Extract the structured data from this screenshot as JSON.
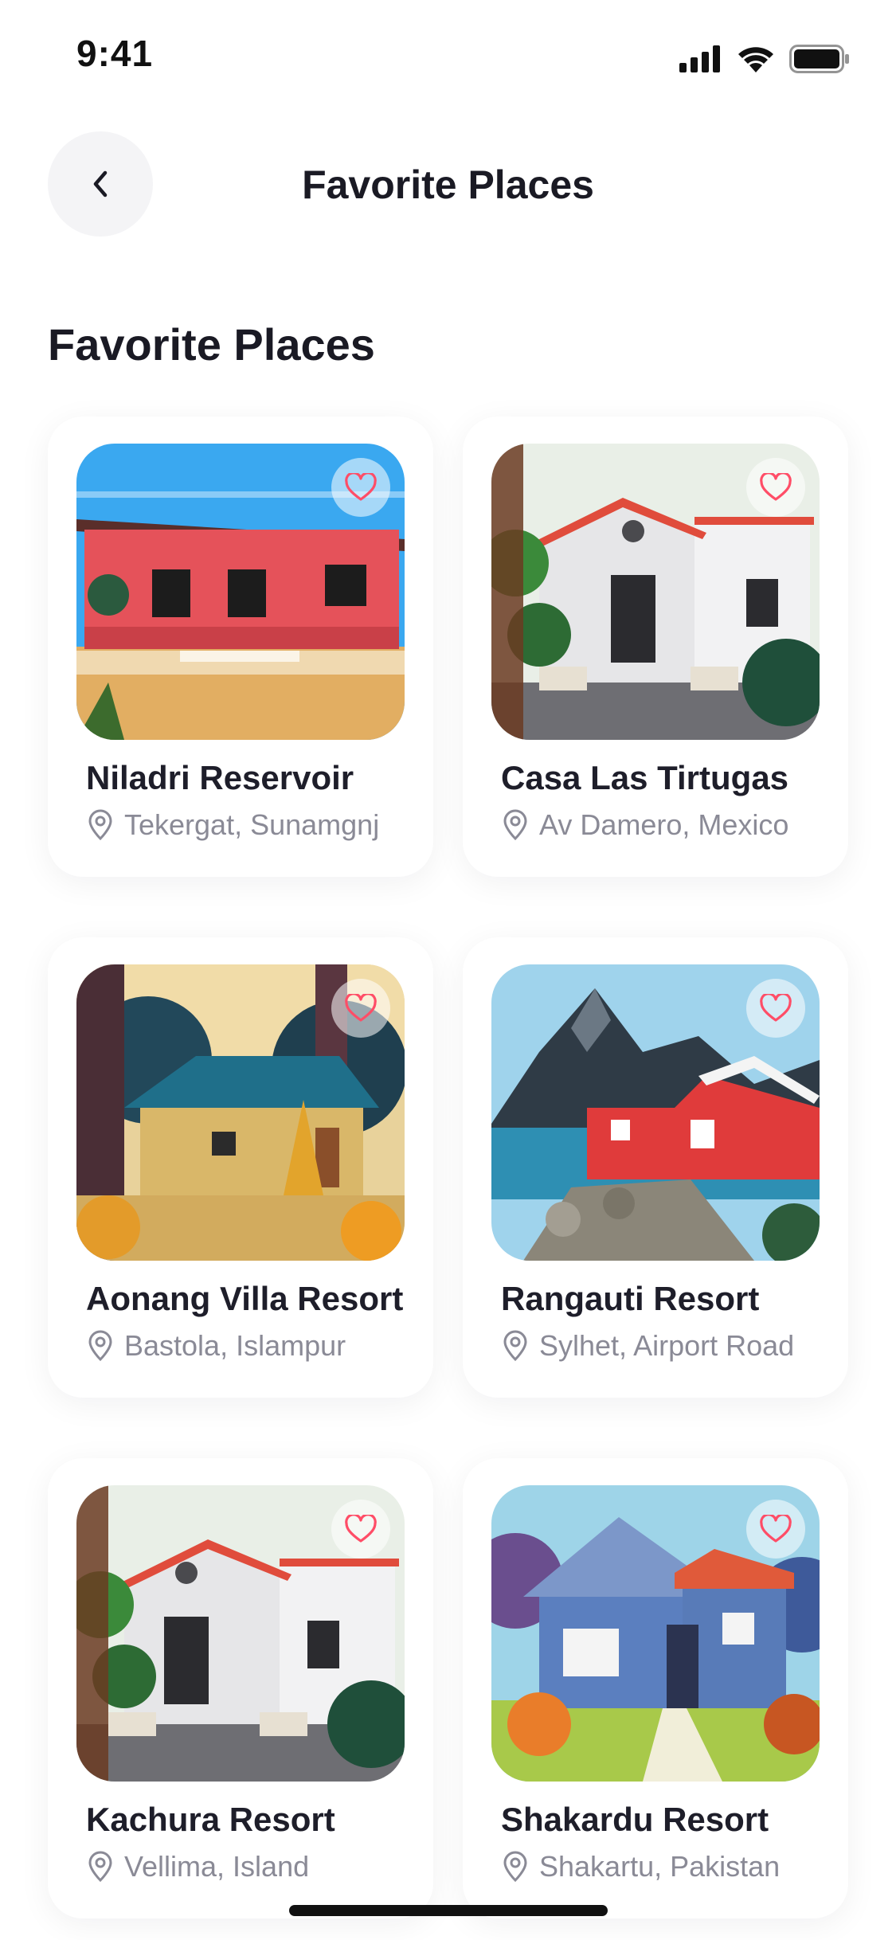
{
  "status_bar": {
    "time": "9:41"
  },
  "nav": {
    "title": "Favorite Places"
  },
  "section": {
    "title": "Favorite Places"
  },
  "places": [
    {
      "name": "Niladri Reservoir",
      "location": "Tekergat, Sunamgnj",
      "favorite": true
    },
    {
      "name": "Casa Las Tirtugas",
      "location": "Av Damero, Mexico",
      "favorite": true
    },
    {
      "name": "Aonang Villa Resort",
      "location": "Bastola, Islampur",
      "favorite": true
    },
    {
      "name": "Rangauti Resort",
      "location": "Sylhet, Airport Road",
      "favorite": true
    },
    {
      "name": "Kachura Resort",
      "location": "Vellima, Island",
      "favorite": true
    },
    {
      "name": "Shakardu Resort",
      "location": "Shakartu, Pakistan",
      "favorite": true
    }
  ],
  "colors": {
    "heart": "#ff4d67",
    "muted_text": "#8a8a96",
    "card_bg": "#ffffff"
  },
  "icons": {
    "back": "chevron-left-icon",
    "favorite": "heart-icon",
    "location": "location-pin-icon"
  }
}
